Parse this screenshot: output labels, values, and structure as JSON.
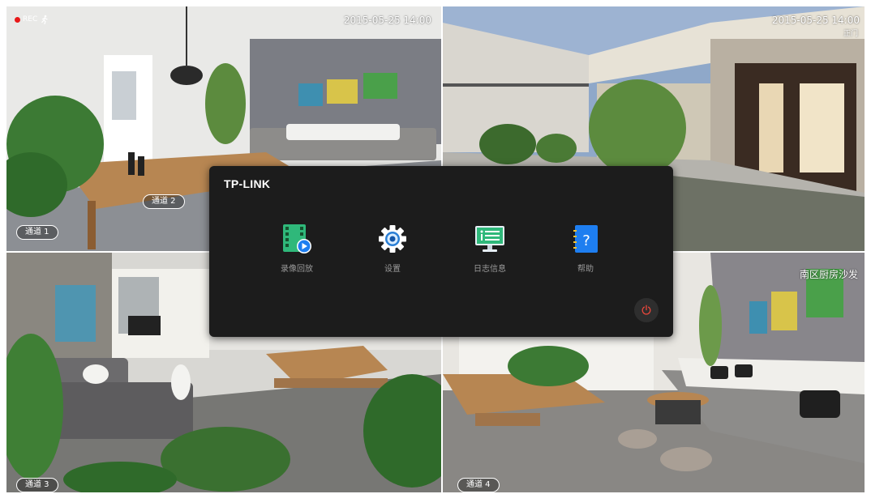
{
  "status": {
    "rec_label": "REC"
  },
  "cameras": {
    "cam1": {
      "timestamp": "2015-05-25  14:00",
      "channel": "通道 1",
      "overlay_channel": "通道 2"
    },
    "cam2": {
      "timestamp": "2015-05-25  14:00",
      "sublabel": "正门"
    },
    "cam3": {
      "channel": "通道 3"
    },
    "cam4": {
      "channel": "通道 4",
      "name": "南区厨房沙发"
    }
  },
  "menu": {
    "brand": "TP-LINK",
    "items": [
      {
        "label": "录像回放",
        "icon": "video-playback-icon"
      },
      {
        "label": "设置",
        "icon": "gear-icon"
      },
      {
        "label": "日志信息",
        "icon": "monitor-log-icon"
      },
      {
        "label": "帮助",
        "icon": "help-book-icon"
      }
    ],
    "power_icon": "power-icon"
  },
  "colors": {
    "accent_green": "#2fb87a",
    "help_blue": "#1e7ef0",
    "power_red": "#e8473b",
    "rec_red": "#e81818"
  }
}
